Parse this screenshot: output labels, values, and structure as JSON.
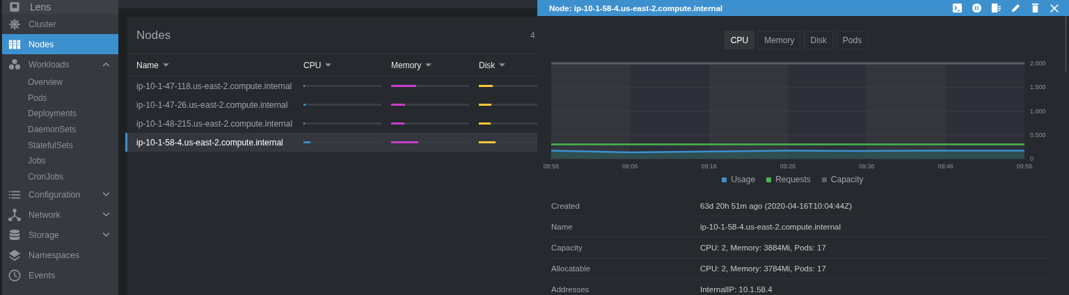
{
  "app": {
    "logo": "Lens"
  },
  "sidebar": {
    "items": [
      {
        "label": "Cluster",
        "selected": false
      },
      {
        "label": "Nodes",
        "selected": true
      },
      {
        "label": "Workloads",
        "selected": false,
        "expanded": true,
        "children": [
          {
            "label": "Overview"
          },
          {
            "label": "Pods"
          },
          {
            "label": "Deployments"
          },
          {
            "label": "DaemonSets"
          },
          {
            "label": "StatefulSets"
          },
          {
            "label": "Jobs"
          },
          {
            "label": "CronJobs"
          }
        ]
      },
      {
        "label": "Configuration",
        "selected": false,
        "expanded": false
      },
      {
        "label": "Network",
        "selected": false,
        "expanded": false
      },
      {
        "label": "Storage",
        "selected": false,
        "expanded": false
      },
      {
        "label": "Namespaces",
        "selected": false
      },
      {
        "label": "Events",
        "selected": false
      }
    ]
  },
  "nodes_panel": {
    "title": "Nodes",
    "count": "4",
    "columns": [
      {
        "label": "Name"
      },
      {
        "label": "CPU"
      },
      {
        "label": "Memory"
      },
      {
        "label": "Disk"
      }
    ],
    "rows": [
      {
        "name": "ip-10-1-47-118.us-east-2.compute.internal",
        "cpu": {
          "level": 0.02
        },
        "memory": {
          "level": 0.32
        },
        "disk": {
          "level": 0.18
        },
        "selected": false
      },
      {
        "name": "ip-10-1-47-26.us-east-2.compute.internal",
        "cpu": {
          "level": 0.03
        },
        "memory": {
          "level": 0.18
        },
        "disk": {
          "level": 0.16
        },
        "selected": false
      },
      {
        "name": "ip-10-1-48-215.us-east-2.compute.internal",
        "cpu": {
          "level": 0.02
        },
        "memory": {
          "level": 0.17
        },
        "disk": {
          "level": 0.15
        },
        "selected": false
      },
      {
        "name": "ip-10-1-58-4.us-east-2.compute.internal",
        "cpu": {
          "level": 0.09
        },
        "memory": {
          "level": 0.35
        },
        "disk": {
          "level": 0.21
        },
        "selected": true
      }
    ]
  },
  "drawer": {
    "title": "Node: ip-10-1-58-4.us-east-2.compute.internal",
    "actions": [
      {
        "kind": "terminal"
      },
      {
        "kind": "cordon"
      },
      {
        "kind": "drain"
      },
      {
        "kind": "edit"
      },
      {
        "kind": "delete"
      },
      {
        "kind": "close"
      }
    ],
    "tabs": [
      {
        "label": "CPU",
        "selected": true
      },
      {
        "label": "Memory",
        "selected": false
      },
      {
        "label": "Disk",
        "selected": false
      },
      {
        "label": "Pods",
        "selected": false
      }
    ],
    "chart_data": {
      "type": "line",
      "x": [
        "08:56",
        "09:06",
        "09:16",
        "09:26",
        "09:36",
        "09:46",
        "09:56"
      ],
      "grid": true,
      "yticks": [
        {
          "value": 0,
          "label": "0"
        },
        {
          "value": 0.5,
          "label": "0.500"
        },
        {
          "value": 1,
          "label": "1.000"
        },
        {
          "value": 1.5,
          "label": "1.500"
        },
        {
          "value": 2,
          "label": "2.000"
        }
      ],
      "ylim": [
        0,
        2
      ],
      "series": [
        {
          "name": "Usage",
          "color": "#3d90ce",
          "values": [
            0.17,
            0.13,
            0.15,
            0.17,
            0.16,
            0.17,
            0.17
          ]
        },
        {
          "name": "Requests",
          "color": "#48b84a",
          "values": [
            0.3,
            0.3,
            0.3,
            0.3,
            0.3,
            0.3,
            0.3
          ]
        },
        {
          "name": "Capacity",
          "color": "#5b5f66",
          "values": [
            2,
            2,
            2,
            2,
            2,
            2,
            2
          ]
        }
      ]
    },
    "details": [
      {
        "label": "Created",
        "value": "63d 20h 51m ago (2020-04-16T10:04:44Z)"
      },
      {
        "label": "Name",
        "value": "ip-10-1-58-4.us-east-2.compute.internal"
      },
      {
        "label": "Capacity",
        "value": "CPU: 2, Memory: 3884Mi, Pods: 17"
      },
      {
        "label": "Allocatable",
        "value": "CPU: 2, Memory: 3784Mi, Pods: 17"
      },
      {
        "label": "Addresses",
        "value": "InternalIP: 10.1.58.4"
      }
    ]
  }
}
